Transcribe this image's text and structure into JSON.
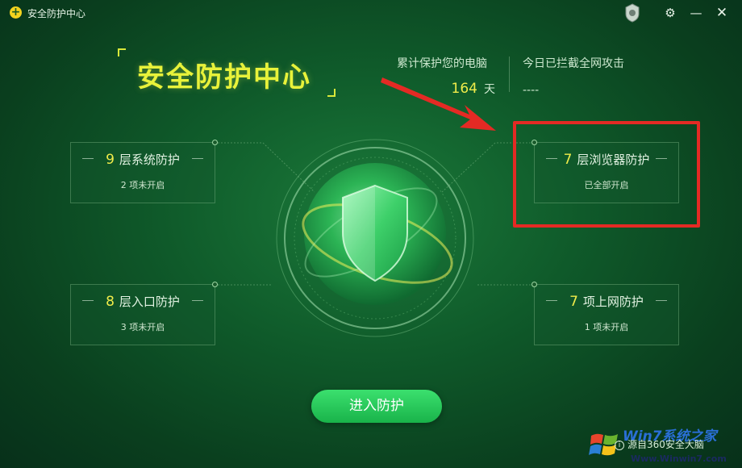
{
  "window": {
    "title": "安全防护中心",
    "app_icon": "plus-circle-icon",
    "controls": {
      "badge": "shield-badge-icon",
      "settings": "gear-icon",
      "minimize": "minimize-icon",
      "close": "close-icon"
    }
  },
  "header": {
    "title": "安全防护中心",
    "stats": [
      {
        "label": "累计保护您的电脑",
        "value": "164",
        "unit": "天"
      },
      {
        "label": "今日已拦截全网攻击",
        "value": "----"
      }
    ]
  },
  "cards": [
    {
      "number": "9",
      "label": "层系统防护",
      "status": "2 项未开启"
    },
    {
      "number": "7",
      "label": "层浏览器防护",
      "status": "已全部开启"
    },
    {
      "number": "8",
      "label": "层入口防护",
      "status": "3 项未开启"
    },
    {
      "number": "7",
      "label": "项上网防护",
      "status": "1 项未开启"
    }
  ],
  "center": {
    "icon": "shield-icon"
  },
  "actions": {
    "enter_label": "进入防护"
  },
  "footer": {
    "source_text": "源自360安全大脑"
  },
  "watermark": {
    "site": "Win7系统之家",
    "url": "Www.Winwin7.com"
  },
  "colors": {
    "accent_yellow": "#f0ec4a",
    "highlight_red": "#e42a24",
    "button_green": "#22c455",
    "background": "#0f5a2a"
  }
}
